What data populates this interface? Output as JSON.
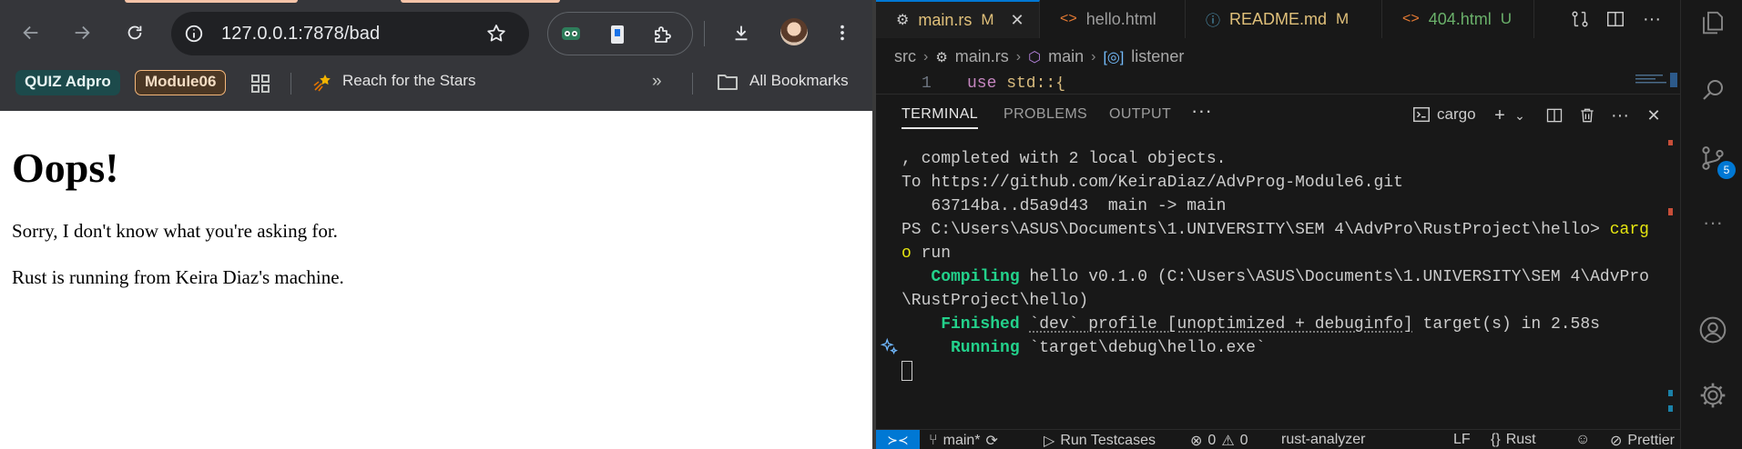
{
  "browser": {
    "url": "127.0.0.1:7878/bad",
    "bookmarks": {
      "quiz": "QUIZ Adpro",
      "module": "Module06",
      "stars": "Reach for the Stars",
      "more": "»",
      "all": "All Bookmarks"
    },
    "page": {
      "heading": "Oops!",
      "line1": "Sorry, I don't know what you're asking for.",
      "line2": "Rust is running from Keira Diaz's machine."
    }
  },
  "vscode": {
    "tabs": [
      {
        "label": "main.rs",
        "status": "M",
        "icon": "rust-file-icon"
      },
      {
        "label": "hello.html",
        "status": "",
        "icon": "html-file-icon"
      },
      {
        "label": "README.md",
        "status": "M",
        "icon": "info-icon"
      },
      {
        "label": "404.html",
        "status": "U",
        "icon": "html-file-icon"
      }
    ],
    "breadcrumb": {
      "folder": "src",
      "file": "main.rs",
      "fn": "main",
      "var": "listener"
    },
    "code": {
      "line_number": "1",
      "text_kw": "use",
      "text_rest": " std::{"
    },
    "panel_tabs": {
      "terminal": "TERMINAL",
      "problems": "PROBLEMS",
      "output": "OUTPUT",
      "more": "···"
    },
    "terminal_profile": "cargo",
    "terminal": {
      "l1": ", completed with 2 local objects.",
      "l2": "To https://github.com/KeiraDiaz/AdvProg-Module6.git",
      "l3": "   63714ba..d5a9d43  main -> main",
      "l4_prompt": "PS C:\\Users\\ASUS\\Documents\\1.UNIVERSITY\\SEM 4\\AdvPro\\RustProject\\hello> ",
      "l4_cmd": "carg",
      "l5_cmd": "o",
      "l5_rest": " run",
      "compiling_label": "   Compiling",
      "compiling_rest": " hello v0.1.0 (C:\\Users\\ASUS\\Documents\\1.UNIVERSITY\\SEM 4\\AdvPro",
      "compiling_rest2": "\\RustProject\\hello)",
      "finished_label": "    Finished",
      "finished_pre": " ",
      "finished_ul": "`dev` profile [unoptimized + debuginfo]",
      "finished_post": " target(s) in 2.58s",
      "running_label": "     Running",
      "running_rest": " `target\\debug\\hello.exe`"
    },
    "statusbar": {
      "branch": "main*",
      "run_testcases": "Run Testcases",
      "errors": "0",
      "warnings": "0",
      "analyzer": "rust-analyzer",
      "eol": "LF",
      "lang_braces": "{}",
      "lang": "Rust",
      "prettier": "Prettier"
    },
    "scm_badge": "5"
  },
  "colors": {
    "terminal_green": "#23d18b",
    "terminal_yellow": "#e5e510",
    "vscode_accent": "#0078d4",
    "modified": "#e0c07a",
    "untracked": "#6ab06a"
  }
}
